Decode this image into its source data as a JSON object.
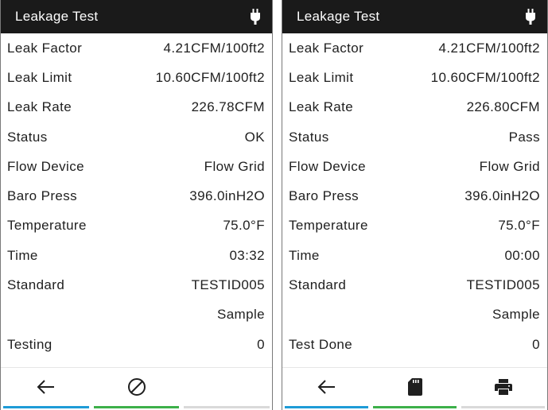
{
  "left_panel": {
    "title": "Leakage Test",
    "power_icon": "plug-icon",
    "rows": [
      {
        "label": "Leak Factor",
        "value": "4.21CFM/100ft2"
      },
      {
        "label": "Leak Limit",
        "value": "10.60CFM/100ft2"
      },
      {
        "label": "Leak Rate",
        "value": "226.78CFM"
      },
      {
        "label": "Status",
        "value": "OK"
      },
      {
        "label": "Flow Device",
        "value": "Flow Grid"
      },
      {
        "label": "Baro Press",
        "value": "396.0inH2O"
      },
      {
        "label": "Temperature",
        "value": "75.0°F"
      },
      {
        "label": "Time",
        "value": "03:32"
      },
      {
        "label": "Standard",
        "value": "TESTID005"
      },
      {
        "label": "",
        "value": "Sample"
      },
      {
        "label": "Testing",
        "value": "0"
      }
    ],
    "footer": [
      {
        "icon": "back-arrow-icon",
        "bar_color": "#1e9bd7"
      },
      {
        "icon": "cancel-icon",
        "bar_color": "#3cb04a"
      },
      {
        "icon": "",
        "bar_color": "#d9d9d9"
      }
    ]
  },
  "right_panel": {
    "title": "Leakage Test",
    "power_icon": "plug-icon",
    "rows": [
      {
        "label": "Leak Factor",
        "value": "4.21CFM/100ft2"
      },
      {
        "label": "Leak Limit",
        "value": "10.60CFM/100ft2"
      },
      {
        "label": "Leak Rate",
        "value": "226.80CFM"
      },
      {
        "label": "Status",
        "value": "Pass"
      },
      {
        "label": "Flow Device",
        "value": "Flow Grid"
      },
      {
        "label": "Baro Press",
        "value": "396.0inH2O"
      },
      {
        "label": "Temperature",
        "value": "75.0°F"
      },
      {
        "label": "Time",
        "value": "00:00"
      },
      {
        "label": "Standard",
        "value": "TESTID005"
      },
      {
        "label": "",
        "value": "Sample"
      },
      {
        "label": "Test Done",
        "value": "0"
      }
    ],
    "footer": [
      {
        "icon": "back-arrow-icon",
        "bar_color": "#1e9bd7"
      },
      {
        "icon": "sd-card-icon",
        "bar_color": "#3cb04a"
      },
      {
        "icon": "printer-icon",
        "bar_color": "#d9d9d9"
      }
    ]
  },
  "colors": {
    "header_bg": "#1a1a1a",
    "header_text": "#ffffff",
    "row_text": "#1f1f1f",
    "accent_blue": "#1e9bd7",
    "accent_green": "#3cb04a",
    "inactive_gray": "#d9d9d9"
  }
}
